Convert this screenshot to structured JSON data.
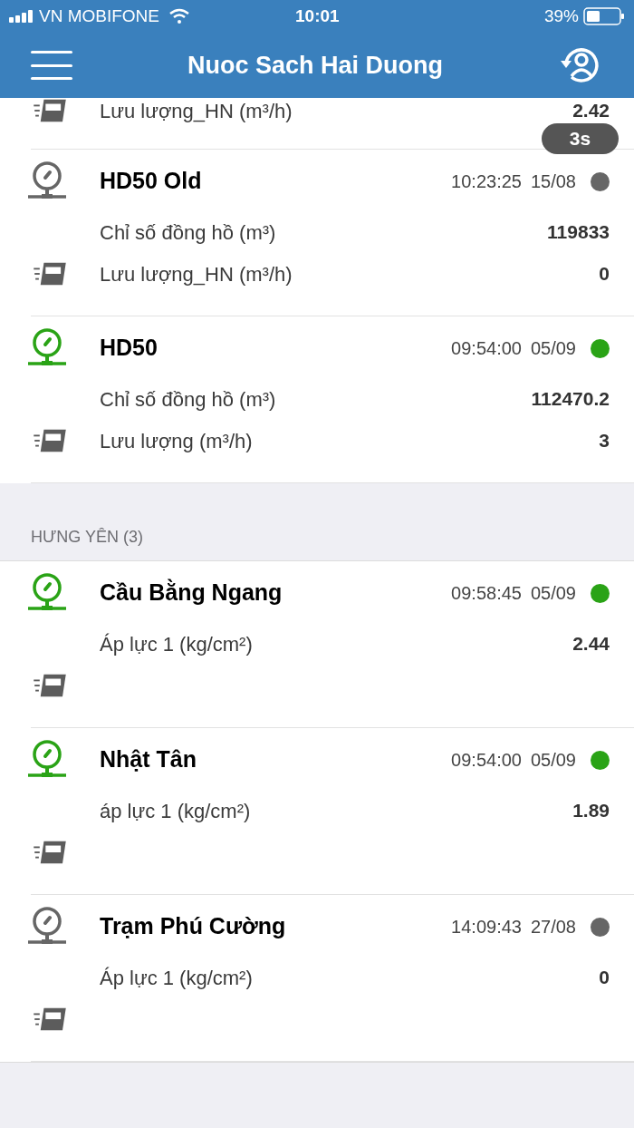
{
  "status_bar": {
    "carrier": "VN MOBIFONE",
    "time": "10:01",
    "battery": "39%"
  },
  "nav": {
    "title": "Nuoc Sach Hai Duong"
  },
  "toast": "3s",
  "stations": [
    {
      "kind": "partial",
      "metrics": [
        {
          "label": "Lưu lượng_HN (m³/h)",
          "value": "2.42"
        }
      ]
    },
    {
      "kind": "full",
      "name": "HD50 Old",
      "time": "10:23:25",
      "date": "15/08",
      "online": false,
      "metrics": [
        {
          "label": "Chỉ số đồng hồ (m³)",
          "value": "119833"
        },
        {
          "label": "Lưu lượng_HN (m³/h)",
          "value": "0"
        }
      ]
    },
    {
      "kind": "full",
      "name": "HD50",
      "time": "09:54:00",
      "date": "05/09",
      "online": true,
      "metrics": [
        {
          "label": "Chỉ số đồng hồ (m³)",
          "value": "112470.2"
        },
        {
          "label": "Lưu lượng (m³/h)",
          "value": "3"
        }
      ]
    }
  ],
  "sections": [
    {
      "header": "HƯNG YÊN (3)",
      "stations": [
        {
          "kind": "full",
          "name": "Cầu Bằng Ngang",
          "time": "09:58:45",
          "date": "05/09",
          "online": true,
          "metrics": [
            {
              "label": "Áp lực 1 (kg/cm²)",
              "value": "2.44"
            }
          ]
        },
        {
          "kind": "full",
          "name": "Nhật Tân",
          "time": "09:54:00",
          "date": "05/09",
          "online": true,
          "metrics": [
            {
              "label": "áp lực 1 (kg/cm²)",
              "value": "1.89"
            }
          ]
        },
        {
          "kind": "full",
          "name": "Trạm Phú Cường",
          "time": "14:09:43",
          "date": "27/08",
          "online": false,
          "metrics": [
            {
              "label": "Áp lực 1 (kg/cm²)",
              "value": "0"
            }
          ]
        }
      ]
    }
  ]
}
